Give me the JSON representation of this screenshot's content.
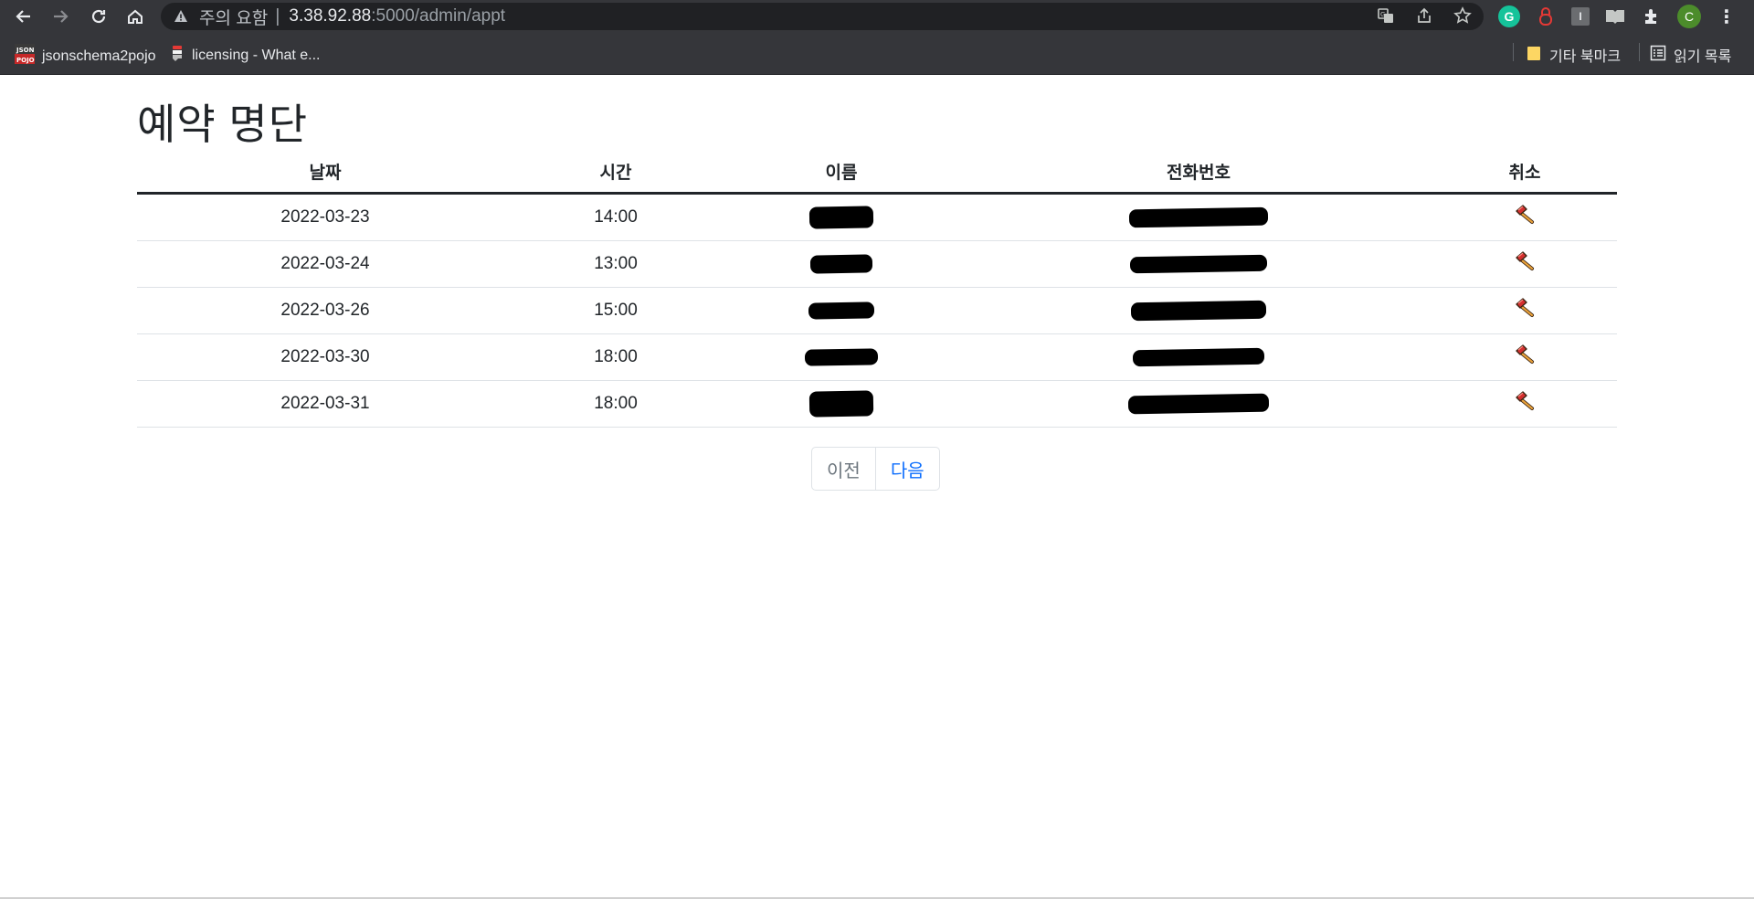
{
  "browser": {
    "security_warning": "주의 요함",
    "url_host": "3.38.92.88",
    "url_rest": ":5000/admin/appt",
    "bookmarks": [
      {
        "label": "jsonschema2pojo"
      },
      {
        "label": "licensing - What e..."
      }
    ],
    "other_bookmarks": "기타 북마크",
    "reading_list": "읽기 목록",
    "profile_initial": "C",
    "colors": {
      "chrome": "#35363a",
      "omnibox": "#202124"
    }
  },
  "page": {
    "title": "예약 명단",
    "columns": [
      "날짜",
      "시간",
      "이름",
      "전화번호",
      "취소"
    ],
    "rows": [
      {
        "date": "2022-03-23",
        "time": "14:00"
      },
      {
        "date": "2022-03-24",
        "time": "13:00"
      },
      {
        "date": "2022-03-26",
        "time": "15:00"
      },
      {
        "date": "2022-03-30",
        "time": "18:00"
      },
      {
        "date": "2022-03-31",
        "time": "18:00"
      }
    ],
    "cancel_icon": "hammer-icon",
    "pagination": {
      "prev": "이전",
      "next": "다음"
    },
    "colors": {
      "text": "#212529",
      "link": "#0d6efd",
      "muted": "#6c757d"
    }
  }
}
